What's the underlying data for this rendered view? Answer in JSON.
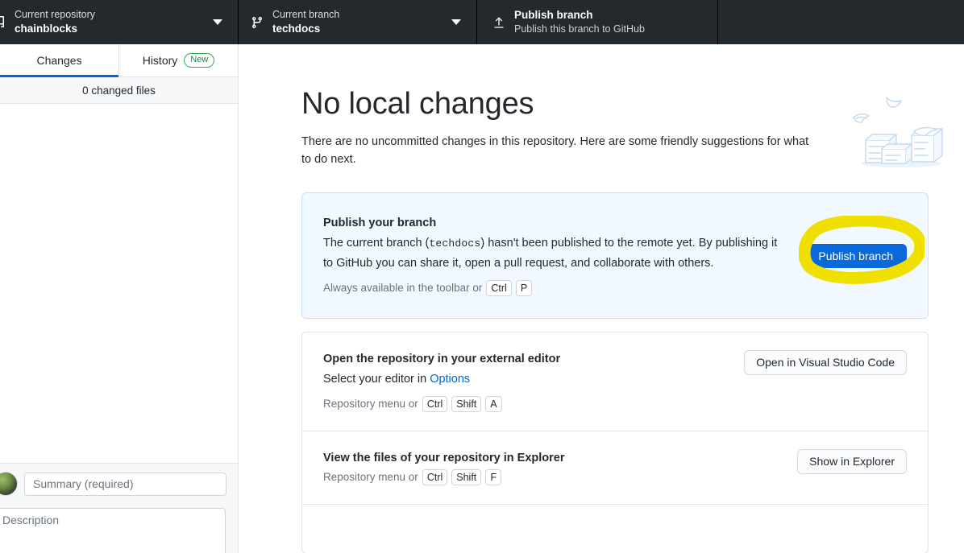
{
  "toolbar": {
    "repository": {
      "icon": "repo-icon",
      "label": "Current repository",
      "value": "chainblocks",
      "caret": "chevron-down-icon"
    },
    "branch": {
      "icon": "git-branch-icon",
      "label": "Current branch",
      "value": "techdocs",
      "caret": "chevron-down-icon"
    },
    "publish": {
      "icon": "upload-icon",
      "title": "Publish branch",
      "subtitle": "Publish this branch to GitHub"
    }
  },
  "sidebar": {
    "tabs": [
      {
        "label": "Changes",
        "active": true
      },
      {
        "label": "History",
        "active": false,
        "badge": "New"
      }
    ],
    "changed_files_text": "0 changed files",
    "commit": {
      "avatar": "user-avatar",
      "summary_placeholder": "Summary (required)",
      "summary_value": "",
      "description_placeholder": "Description",
      "description_value": ""
    }
  },
  "main": {
    "title": "No local changes",
    "subtitle": "There are no uncommitted changes in this repository. Here are some friendly suggestions for what to do next.",
    "illustration": "empty-boxes-illustration",
    "suggestions": [
      {
        "id": "publish-branch",
        "title": "Publish your branch",
        "desc_before": "The current branch (",
        "desc_code": "techdocs",
        "desc_after": ") hasn't been published to the remote yet. By publishing it to GitHub you can share it, open a pull request, and collaborate with others.",
        "hint_text": "Always available in the toolbar or",
        "hint_keys": [
          "Ctrl",
          "P"
        ],
        "button_label": "Publish branch",
        "button_style": "primary",
        "highlighted": true
      },
      {
        "id": "open-external-editor",
        "title": "Open the repository in your external editor",
        "desc_before": "Select your editor in ",
        "desc_link": "Options",
        "desc_after": "",
        "hint_text": "Repository menu or",
        "hint_keys": [
          "Ctrl",
          "Shift",
          "A"
        ],
        "button_label": "Open in Visual Studio Code",
        "button_style": "default",
        "highlighted": false
      },
      {
        "id": "show-in-explorer",
        "title": "View the files of your repository in Explorer",
        "desc_before": "",
        "desc_link": "",
        "desc_after": "",
        "hint_text": "Repository menu or",
        "hint_keys": [
          "Ctrl",
          "Shift",
          "F"
        ],
        "button_label": "Show in Explorer",
        "button_style": "default",
        "highlighted": false
      }
    ]
  },
  "colors": {
    "toolbar_bg": "#24292e",
    "accent_blue": "#0366d6",
    "primary_button": "#0969da",
    "highlight_annotation": "#f0e000",
    "card_highlight_bg": "#f1f8ff",
    "badge_green": "#22863a"
  }
}
